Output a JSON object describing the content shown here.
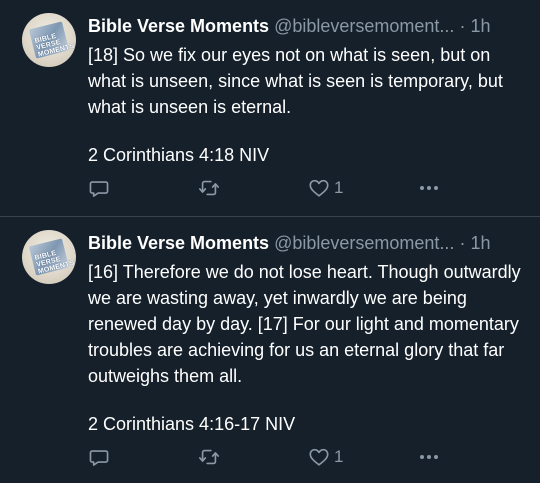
{
  "tweets": [
    {
      "author_name": "Bible Verse Moments",
      "handle": "@bibleversemoment...",
      "separator": "·",
      "time": "1h",
      "text": "[18] So we fix our eyes not on what is seen, but on what is unseen, since what is seen is temporary, but what is unseen is eternal.",
      "reference": "2 Corinthians 4:18 NIV",
      "like_count": "1",
      "avatar_text": "BIBLE VERSE MOMENTS"
    },
    {
      "author_name": "Bible Verse Moments",
      "handle": "@bibleversemoment...",
      "separator": "·",
      "time": "1h",
      "text": "[16] Therefore we do not lose heart. Though outwardly we are wasting away, yet inwardly we are being renewed day by day. [17] For our light and momentary troubles are achieving for us an eternal glory that far outweighs them all.",
      "reference": "2 Corinthians 4:16-17 NIV",
      "like_count": "1",
      "avatar_text": "BIBLE VERSE MOMENTS"
    }
  ],
  "icons": {
    "reply": "reply-icon",
    "retweet": "retweet-icon",
    "like": "heart-icon",
    "more": "more-icon"
  },
  "colors": {
    "background": "#15202b",
    "text_primary": "#ffffff",
    "text_secondary": "#8b98a5",
    "divider": "#38444d"
  }
}
